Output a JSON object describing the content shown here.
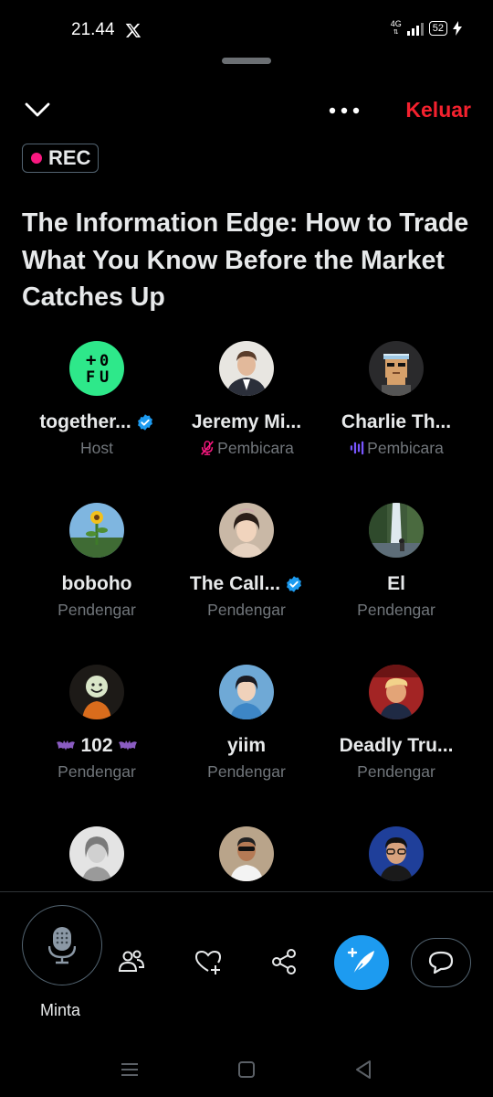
{
  "status_bar": {
    "time": "21.44",
    "network": "4G",
    "battery": "52"
  },
  "header": {
    "leave_label": "Keluar"
  },
  "rec_badge": "REC",
  "space_title": "The Information Edge: How to Trade What You Know Before the Market Catches Up",
  "participants": [
    {
      "name": "together...",
      "role": "Host",
      "verified": true,
      "role_icon": "none",
      "avatar": "tofu-logo"
    },
    {
      "name": "Jeremy Mi...",
      "role": "Pembicara",
      "verified": false,
      "role_icon": "mic-muted-icon",
      "avatar": "photo"
    },
    {
      "name": "Charlie Th...",
      "role": "Pembicara",
      "verified": false,
      "role_icon": "speaking-bars-icon",
      "avatar": "pixel-art"
    },
    {
      "name": "boboho",
      "role": "Pendengar",
      "verified": false,
      "avatar": "photo"
    },
    {
      "name": "The Call...",
      "role": "Pendengar",
      "verified": true,
      "avatar": "photo"
    },
    {
      "name": "El",
      "role": "Pendengar",
      "verified": false,
      "avatar": "photo"
    },
    {
      "name": "102",
      "role": "Pendengar",
      "verified": false,
      "avatar": "photo",
      "name_decor": "bat-emoji"
    },
    {
      "name": "yiim",
      "role": "Pendengar",
      "verified": false,
      "avatar": "photo"
    },
    {
      "name": "Deadly Tru...",
      "role": "Pendengar",
      "verified": false,
      "avatar": "photo"
    },
    {
      "name": "",
      "role": "",
      "avatar": "photo"
    },
    {
      "name": "",
      "role": "",
      "avatar": "photo"
    },
    {
      "name": "",
      "role": "",
      "avatar": "photo"
    }
  ],
  "bottom_bar": {
    "request_label": "Minta",
    "icons": [
      "mic-icon",
      "people-icon",
      "heart-add-icon",
      "share-icon",
      "compose-icon",
      "chat-icon"
    ]
  },
  "colors": {
    "background": "#000000",
    "accent_blue": "#1d9bf0",
    "leave_red": "#f4212e",
    "rec_pink": "#f91880",
    "speaker_purple": "#7856ff",
    "text_secondary": "#71767b"
  }
}
